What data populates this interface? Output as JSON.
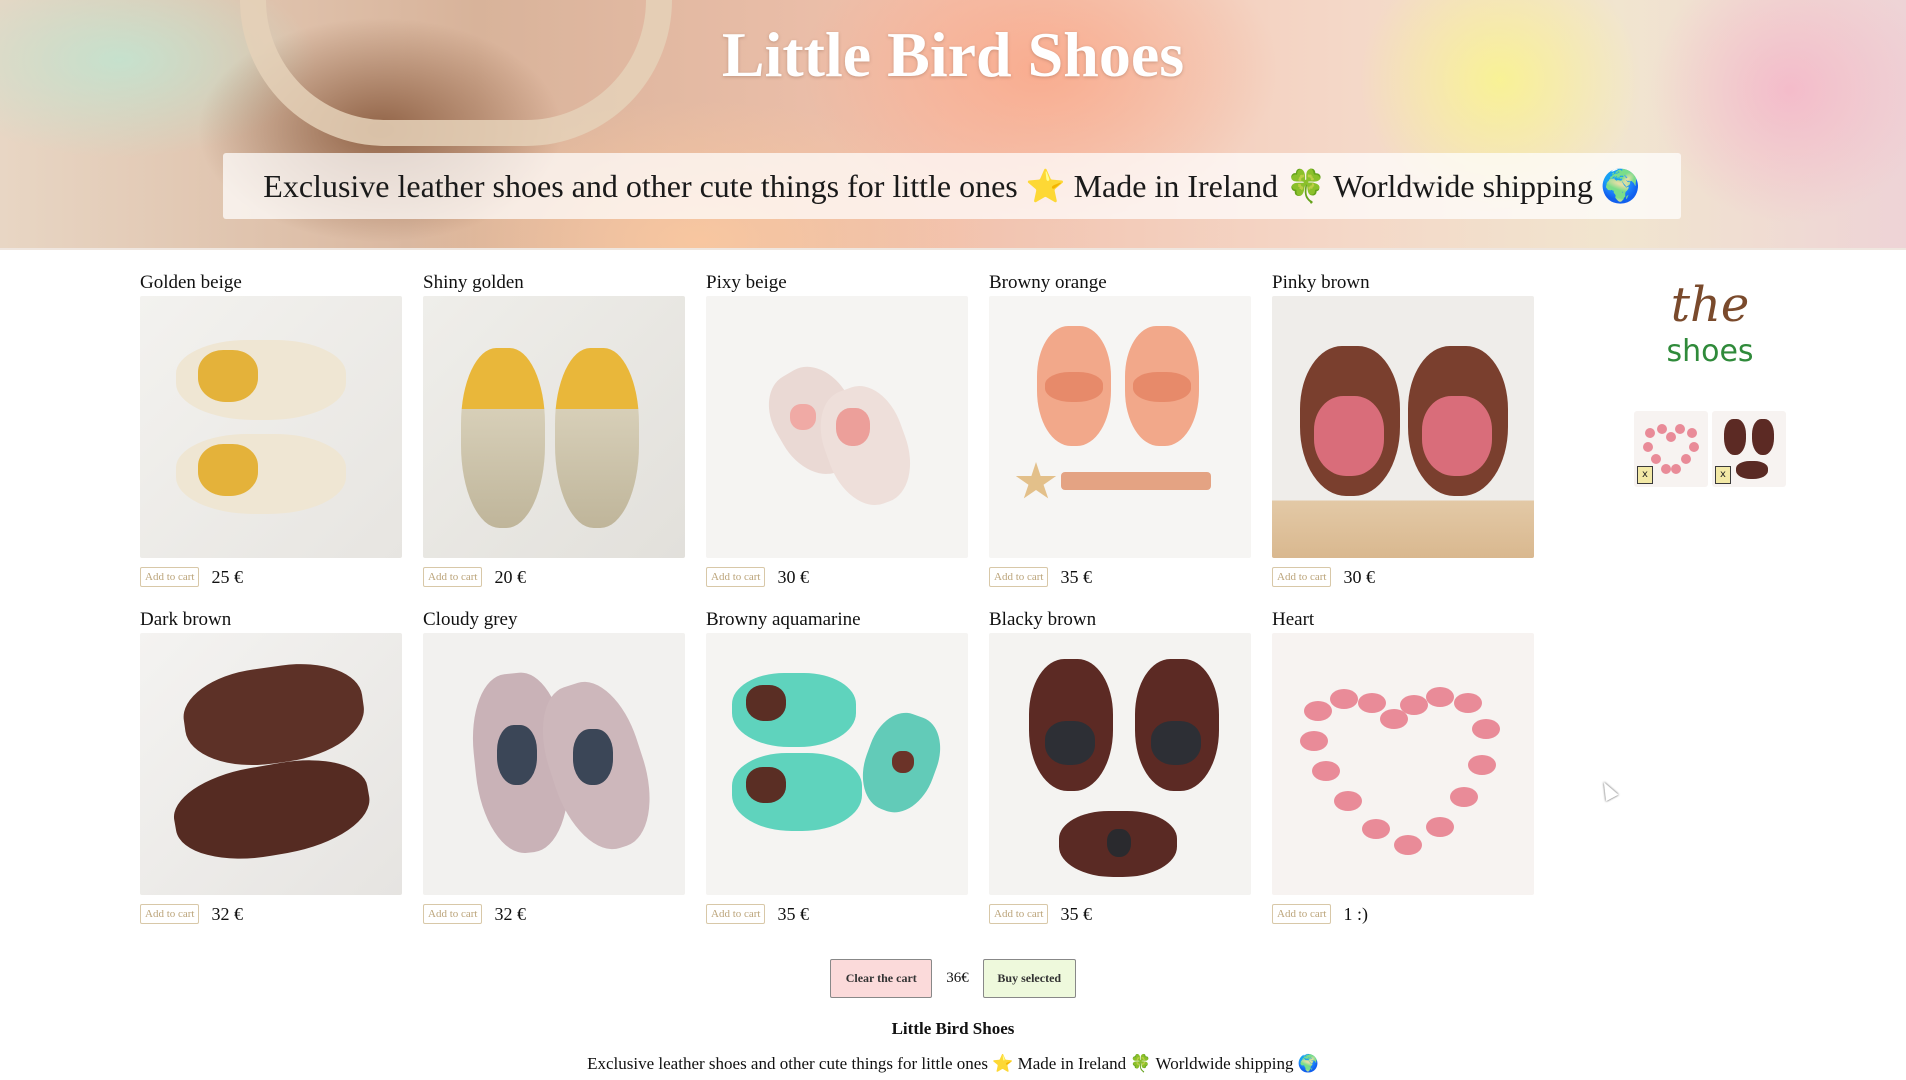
{
  "header": {
    "title": "Little Bird Shoes",
    "tagline": "Exclusive leather shoes and other cute things for little ones ⭐ Made in Ireland 🍀 Worldwide shipping 🌍"
  },
  "add_to_cart_label": "Add to cart",
  "products": [
    {
      "name": "Golden beige",
      "price": "25 €"
    },
    {
      "name": "Shiny golden",
      "price": "20 €"
    },
    {
      "name": "Pixy beige",
      "price": "30 €"
    },
    {
      "name": "Browny orange",
      "price": "35 €"
    },
    {
      "name": "Pinky brown",
      "price": "30 €"
    },
    {
      "name": "Dark brown",
      "price": "32 €"
    },
    {
      "name": "Cloudy grey",
      "price": "32 €"
    },
    {
      "name": "Browny aquamarine",
      "price": "35 €"
    },
    {
      "name": "Blacky brown",
      "price": "35 €"
    },
    {
      "name": "Heart",
      "price": "1 :)"
    }
  ],
  "sidebar": {
    "logo_top": "the",
    "logo_bottom": "shoes",
    "cart_items": [
      {
        "item": "Heart",
        "remove_label": "x"
      },
      {
        "item": "Blacky brown",
        "remove_label": "x"
      }
    ]
  },
  "cart": {
    "clear_label": "Clear the cart",
    "total": "36€",
    "buy_label": "Buy selected"
  },
  "footer": {
    "title": "Little Bird Shoes",
    "tagline": "Exclusive leather shoes and other cute things for little ones ⭐ Made in Ireland 🍀 Worldwide shipping 🌍"
  },
  "colors": {
    "clear_button": "#fbdada",
    "buy_button": "#eef9dc",
    "logo_brown": "#7a4a2c",
    "logo_green": "#2f8a3a"
  }
}
